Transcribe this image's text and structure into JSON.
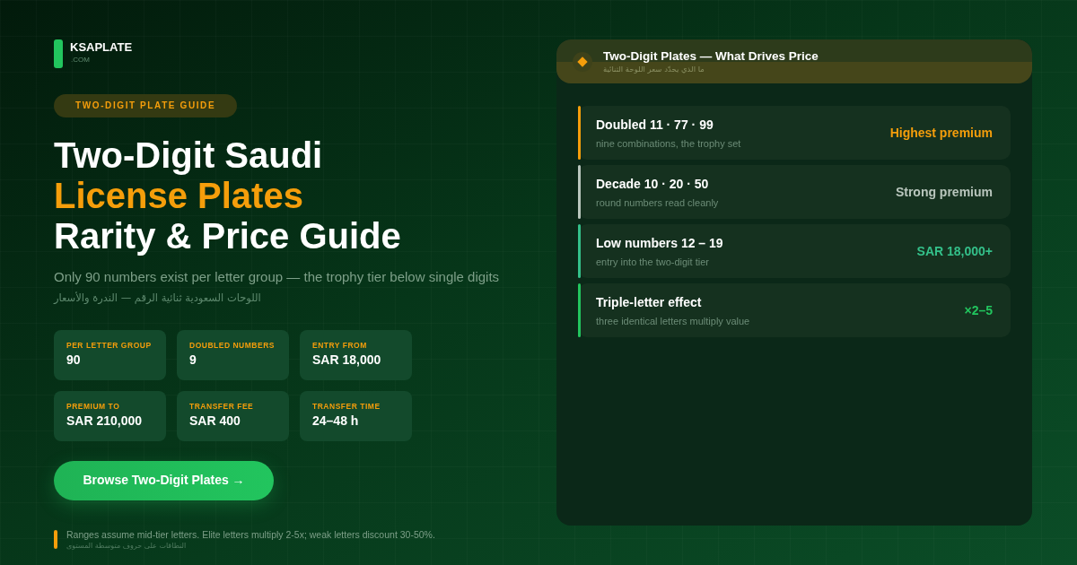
{
  "brand": {
    "name": "KSAPLATE",
    "domain": ".COM"
  },
  "badge": "TWO-DIGIT PLATE GUIDE",
  "headline": [
    {
      "text": "Two-Digit Saudi",
      "highlight": false
    },
    {
      "text": "License Plates",
      "highlight": true
    },
    {
      "text": "Rarity & Price Guide",
      "highlight": false
    }
  ],
  "subtitle": "Only 90 numbers exist per letter group — the trophy tier below single digits",
  "subtitle_ar": "اللوحات السعودية ثنائية الرقم — الندرة والأسعار",
  "stats": [
    {
      "label": "PER LETTER GROUP",
      "value": "90"
    },
    {
      "label": "DOUBLED NUMBERS",
      "value": "9"
    },
    {
      "label": "ENTRY FROM",
      "value": "SAR 18,000"
    },
    {
      "label": "PREMIUM TO",
      "value": "SAR 210,000"
    },
    {
      "label": "TRANSFER FEE",
      "value": "SAR 400"
    },
    {
      "label": "TRANSFER TIME",
      "value": "24–48 h"
    }
  ],
  "cta": {
    "label": "Browse Two-Digit Plates →"
  },
  "footnote": {
    "text": "Ranges assume mid-tier letters. Elite letters multiply 2-5x; weak letters discount 30-50%.",
    "text_ar": "النطاقات على حروف متوسطة المستوى"
  },
  "panel": {
    "title": "Two-Digit Plates — What Drives Price",
    "subtitle_ar": "ما الذي يحدّد سعر اللوحة الثنائية",
    "rows": [
      {
        "title": "Doubled 11 · 77 · 99",
        "detail": "nine combinations, the trophy set",
        "value": "Highest premium",
        "color": "#f59e0b"
      },
      {
        "title": "Decade 10 · 20 · 50",
        "detail": "round numbers read cleanly",
        "value": "Strong premium",
        "color": "#b9c6bd"
      },
      {
        "title": "Low numbers 12 – 19",
        "detail": "entry into the two-digit tier",
        "value": "SAR 18,000+",
        "color": "#34c08a"
      },
      {
        "title": "Triple-letter effect",
        "detail": "three identical letters multiply value",
        "value": "×2–5",
        "color": "#22c55e"
      }
    ]
  }
}
